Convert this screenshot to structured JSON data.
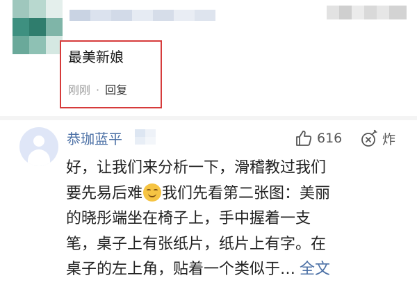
{
  "first_comment": {
    "reply_text": "最美新娘",
    "time": "刚刚",
    "separator": "·",
    "reply_action": "回复"
  },
  "second_comment": {
    "username": "恭珈蓝平",
    "like_count": "616",
    "bomb_label": "炸",
    "lines": [
      "好，让我们来分析一下，滑稽教过我们",
      "要先易后难",
      "我们先看第二张图：美丽",
      "的晓彤端坐在椅子上，手中握着一支",
      "笔，桌子上有张纸片，纸片上有字。在",
      "桌子的左上角，贴着一个类似于…"
    ],
    "emoji_icon": "funny-face-emoji",
    "full_text_link": "全文"
  },
  "icons": {
    "like": "thumbs-up-icon",
    "bomb": "bomb-icon",
    "avatar": "default-avatar-icon"
  },
  "colors": {
    "highlight_border": "#d63b3b",
    "username": "#4a6fa5",
    "meta_gray": "#9a9a9a",
    "avatar_bg": "#dfe6f7"
  }
}
